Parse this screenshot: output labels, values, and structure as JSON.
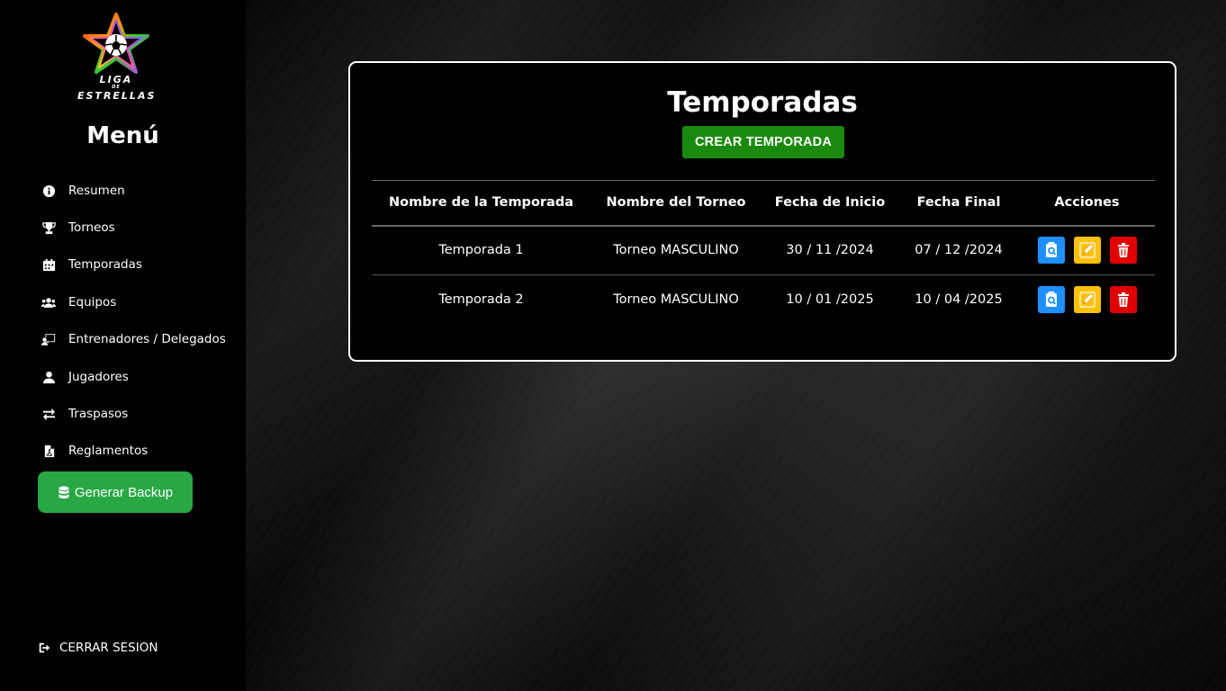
{
  "brand": {
    "line1": "LIGA",
    "line_small": "DE",
    "line2": "ESTRELLAS"
  },
  "sidebar": {
    "title": "Menú",
    "items": [
      {
        "label": "Resumen",
        "icon": "info-circle-icon"
      },
      {
        "label": "Torneos",
        "icon": "trophy-icon"
      },
      {
        "label": "Temporadas",
        "icon": "calendar-icon"
      },
      {
        "label": "Equipos",
        "icon": "users-icon"
      },
      {
        "label": "Entrenadores / Delegados",
        "icon": "chalkboard-teacher-icon"
      },
      {
        "label": "Jugadores",
        "icon": "user-icon"
      },
      {
        "label": "Traspasos",
        "icon": "exchange-icon"
      },
      {
        "label": "Reglamentos",
        "icon": "file-pdf-icon"
      }
    ],
    "backup_label": "Generar Backup",
    "logout_label": "CERRAR SESION"
  },
  "main": {
    "title": "Temporadas",
    "create_label": "CREAR TEMPORADA",
    "columns": [
      "Nombre de la Temporada",
      "Nombre del Torneo",
      "Fecha de Inicio",
      "Fecha Final",
      "Acciones"
    ],
    "rows": [
      {
        "name": "Temporada 1",
        "tournament": "Torneo MASCULINO",
        "start": "30 / 11 /2024",
        "end": "07 / 12 /2024"
      },
      {
        "name": "Temporada 2",
        "tournament": "Torneo MASCULINO",
        "start": "10 / 01 /2025",
        "end": "10 / 04 /2025"
      }
    ]
  },
  "colors": {
    "backup_green": "#28a745",
    "create_green": "#1a8a0e",
    "view_blue": "#1e90ff",
    "edit_yellow": "#ffc107",
    "delete_red": "#e00000"
  }
}
